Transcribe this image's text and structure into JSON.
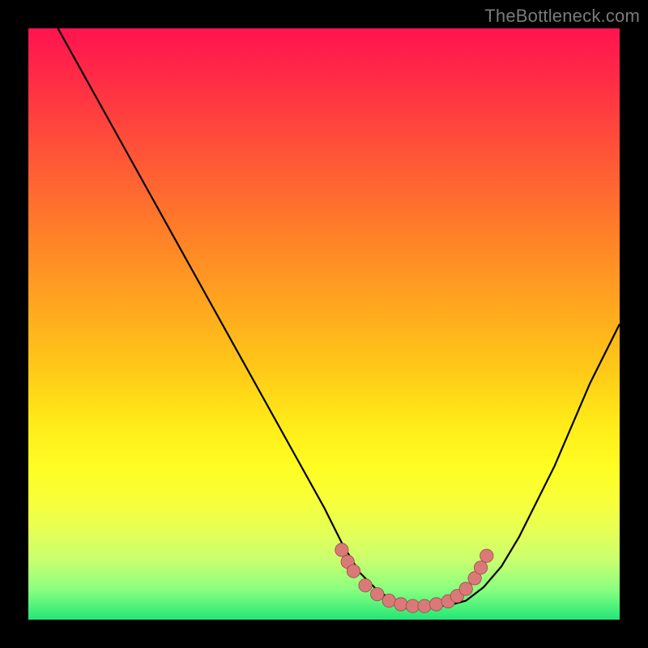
{
  "watermark": "TheBottleneck.com",
  "colors": {
    "frame": "#000000",
    "curve_stroke": "#000000",
    "marker_fill": "#d97a78",
    "marker_stroke": "#9c4746"
  },
  "chart_data": {
    "type": "line",
    "title": "",
    "xlabel": "",
    "ylabel": "",
    "xlim": [
      0,
      100
    ],
    "ylim": [
      0,
      100
    ],
    "grid": false,
    "series": [
      {
        "name": "curve",
        "x": [
          5,
          10,
          15,
          20,
          25,
          30,
          35,
          40,
          45,
          50,
          53,
          56,
          59,
          62,
          65,
          68,
          71,
          74,
          77,
          80,
          83,
          86,
          89,
          92,
          95,
          100
        ],
        "y": [
          100,
          91,
          82,
          73,
          64,
          55,
          46,
          37,
          28,
          19,
          13,
          8,
          5,
          3,
          2.5,
          2.2,
          2.4,
          3.2,
          5.5,
          9,
          14,
          20,
          26,
          33,
          40,
          50
        ]
      }
    ],
    "markers": [
      {
        "x": 53.0,
        "y": 11.8
      },
      {
        "x": 54.0,
        "y": 9.8
      },
      {
        "x": 55.0,
        "y": 8.2
      },
      {
        "x": 57.0,
        "y": 5.8
      },
      {
        "x": 59.0,
        "y": 4.3
      },
      {
        "x": 61.0,
        "y": 3.2
      },
      {
        "x": 63.0,
        "y": 2.6
      },
      {
        "x": 65.0,
        "y": 2.3
      },
      {
        "x": 67.0,
        "y": 2.3
      },
      {
        "x": 69.0,
        "y": 2.6
      },
      {
        "x": 71.0,
        "y": 3.1
      },
      {
        "x": 72.5,
        "y": 4.0
      },
      {
        "x": 74.0,
        "y": 5.2
      },
      {
        "x": 75.5,
        "y": 7.0
      },
      {
        "x": 76.5,
        "y": 8.8
      },
      {
        "x": 77.5,
        "y": 10.8
      }
    ]
  }
}
